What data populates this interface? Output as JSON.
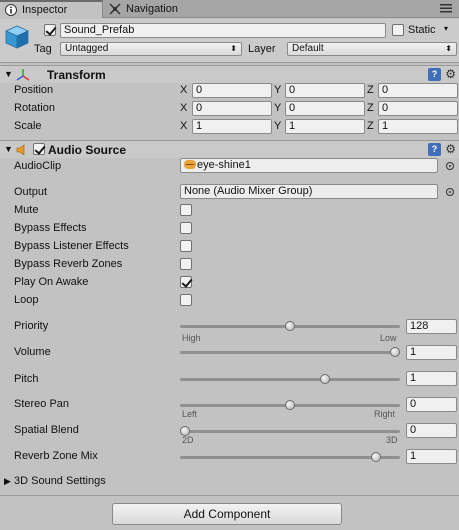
{
  "tabs": [
    {
      "label": "Inspector",
      "icon": "info-icon"
    },
    {
      "label": "Navigation",
      "icon": "navigation-icon"
    }
  ],
  "gameobject": {
    "active": true,
    "name": "Sound_Prefab",
    "static_label": "Static",
    "static_checked": false,
    "tag_label": "Tag",
    "tag_value": "Untagged",
    "layer_label": "Layer",
    "layer_value": "Default"
  },
  "transform": {
    "title": "Transform",
    "rows": [
      {
        "label": "Position",
        "x": "0",
        "y": "0",
        "z": "0"
      },
      {
        "label": "Rotation",
        "x": "0",
        "y": "0",
        "z": "0"
      },
      {
        "label": "Scale",
        "x": "1",
        "y": "1",
        "z": "1"
      }
    ],
    "axis_labels": [
      "X",
      "Y",
      "Z"
    ]
  },
  "audio_source": {
    "title": "Audio Source",
    "enabled": true,
    "audioclip_label": "AudioClip",
    "audioclip_value": "eye-shine1",
    "output_label": "Output",
    "output_value": "None (Audio Mixer Group)",
    "toggles": [
      {
        "label": "Mute",
        "checked": false
      },
      {
        "label": "Bypass Effects",
        "checked": false
      },
      {
        "label": "Bypass Listener Effects",
        "checked": false
      },
      {
        "label": "Bypass Reverb Zones",
        "checked": false
      },
      {
        "label": "Play On Awake",
        "checked": true
      },
      {
        "label": "Loop",
        "checked": false
      }
    ],
    "sliders": [
      {
        "label": "Priority",
        "value": "128",
        "fraction": 0.5,
        "min_label": "High",
        "max_label": "Low"
      },
      {
        "label": "Volume",
        "value": "1",
        "fraction": 1.0,
        "min_label": "",
        "max_label": ""
      },
      {
        "label": "Pitch",
        "value": "1",
        "fraction": 0.667,
        "min_label": "",
        "max_label": ""
      },
      {
        "label": "Stereo Pan",
        "value": "0",
        "fraction": 0.5,
        "min_label": "Left",
        "max_label": "Right"
      },
      {
        "label": "Spatial Blend",
        "value": "0",
        "fraction": 0.0,
        "min_label": "2D",
        "max_label": "3D"
      },
      {
        "label": "Reverb Zone Mix",
        "value": "1",
        "fraction": 0.909,
        "min_label": "",
        "max_label": ""
      }
    ],
    "sound_settings_label": "3D Sound Settings"
  },
  "add_component_label": "Add Component",
  "colors": {
    "panel": "#c2c2c2",
    "help": "#3e6fb8",
    "audio_icon": "#e39a2a"
  }
}
